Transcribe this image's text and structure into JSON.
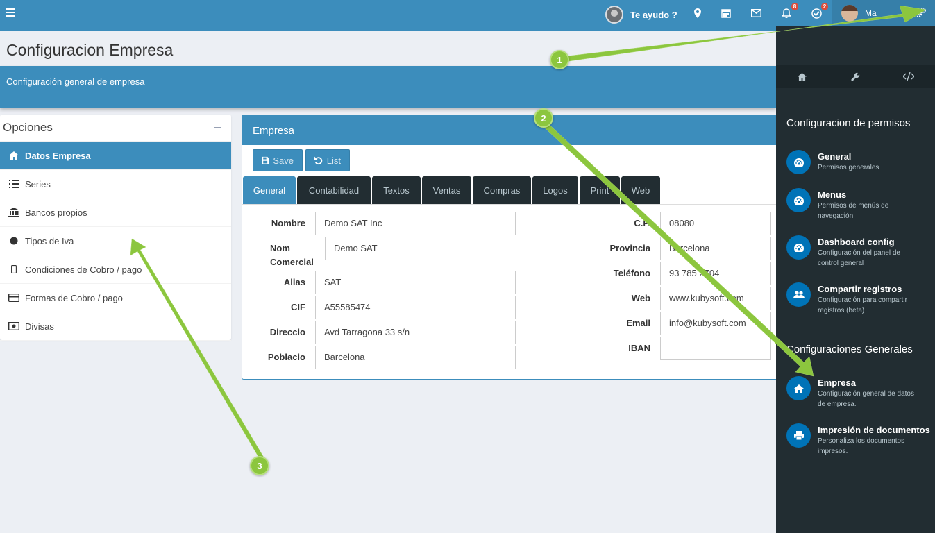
{
  "topbar": {
    "helper_label": "Te ayudo ?",
    "notifications_count": "8",
    "tasks_count": "2",
    "user_name": "Ma"
  },
  "page": {
    "title": "Configuracion Empresa",
    "subtitle": "Configuración general de empresa"
  },
  "options": {
    "title": "Opciones",
    "items": [
      {
        "label": "Datos Empresa",
        "icon": "home-icon"
      },
      {
        "label": "Series",
        "icon": "list-icon"
      },
      {
        "label": "Bancos propios",
        "icon": "bank-icon"
      },
      {
        "label": "Tipos de Iva",
        "icon": "circle-icon"
      },
      {
        "label": "Condiciones de Cobro / pago",
        "icon": "mobile-icon"
      },
      {
        "label": "Formas de Cobro / pago",
        "icon": "credit-card-icon"
      },
      {
        "label": "Divisas",
        "icon": "money-icon"
      }
    ]
  },
  "empresa": {
    "title": "Empresa",
    "save_label": "Save",
    "list_label": "List",
    "tabs": [
      "General",
      "Contabilidad",
      "Textos",
      "Ventas",
      "Compras",
      "Logos",
      "Print",
      "Web"
    ],
    "left_fields": [
      {
        "label": "Nombre",
        "value": "Demo SAT Inc"
      },
      {
        "label": "Nom Comercial",
        "value": "Demo SAT"
      },
      {
        "label": "Alias",
        "value": "SAT"
      },
      {
        "label": "CIF",
        "value": "A55585474"
      },
      {
        "label": "Direccio",
        "value": "Avd Tarragona 33 s/n"
      },
      {
        "label": "Poblacio",
        "value": "Barcelona"
      }
    ],
    "right_fields": [
      {
        "label": "C.P.",
        "value": "08080"
      },
      {
        "label": "Provincia",
        "value": "Barcelona"
      },
      {
        "label": "Teléfono",
        "value": "93 785 2704"
      },
      {
        "label": "Web",
        "value": "www.kubysoft.com"
      },
      {
        "label": "Email",
        "value": "info@kubysoft.com"
      },
      {
        "label": "IBAN",
        "value": ""
      }
    ]
  },
  "sidebar": {
    "heading_permisos": "Configuracion de permisos",
    "permisos": [
      {
        "title": "General",
        "sub": "Permisos generales",
        "icon": "dashboard-icon"
      },
      {
        "title": "Menus",
        "sub": "Permisos de menús de navegación.",
        "icon": "dashboard-icon"
      },
      {
        "title": "Dashboard config",
        "sub": "Configuración del panel de control general",
        "icon": "dashboard-icon"
      },
      {
        "title": "Compartir registros",
        "sub": "Configuración para compartir registros (beta)",
        "icon": "users-icon"
      }
    ],
    "heading_generales": "Configuraciones Generales",
    "generales": [
      {
        "title": "Empresa",
        "sub": "Configuración general de datos de empresa.",
        "icon": "home-icon"
      },
      {
        "title": "Impresión de documentos",
        "sub": "Personaliza los documentos impresos.",
        "icon": "print-icon"
      }
    ]
  },
  "annotations": [
    "1",
    "2",
    "3"
  ],
  "colors": {
    "primary": "#3c8dbc",
    "dark": "#222d32",
    "accent_green": "#8cc63e",
    "badge_red": "#dd4b39"
  }
}
